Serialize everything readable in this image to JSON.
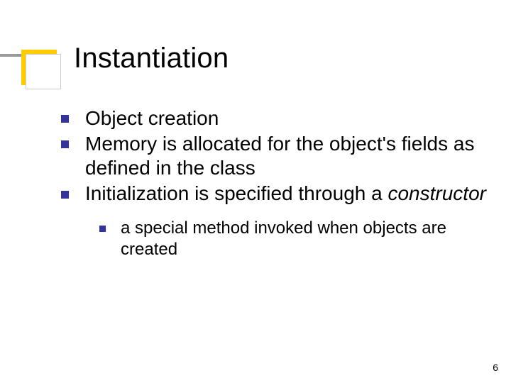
{
  "title": "Instantiation",
  "bullets": {
    "b1": "Object creation",
    "b2": "Memory is allocated for the object's fields as defined in the class",
    "b3_pre": "Initialization is specified through a ",
    "b3_ital": "constructor",
    "sub1": "a special method invoked when objects are created"
  },
  "page_number": "6"
}
